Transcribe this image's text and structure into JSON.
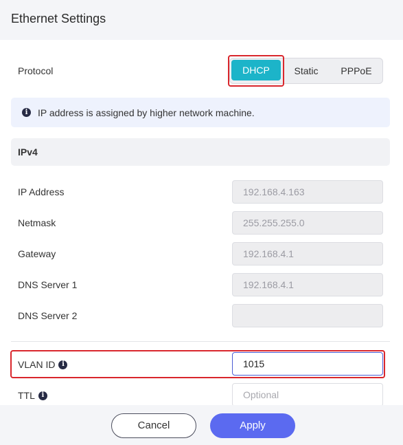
{
  "header": {
    "title": "Ethernet Settings"
  },
  "protocol": {
    "label": "Protocol",
    "options": [
      "DHCP",
      "Static",
      "PPPoE"
    ],
    "selected": "DHCP"
  },
  "info": {
    "text": "IP address is assigned by higher network machine."
  },
  "ipv4": {
    "section_title": "IPv4",
    "fields": [
      {
        "label": "IP Address",
        "value": "192.168.4.163"
      },
      {
        "label": "Netmask",
        "value": "255.255.255.0"
      },
      {
        "label": "Gateway",
        "value": "192.168.4.1"
      },
      {
        "label": "DNS Server 1",
        "value": "192.168.4.1"
      },
      {
        "label": "DNS Server 2",
        "value": ""
      }
    ]
  },
  "vlan": {
    "label": "VLAN ID",
    "value": "1015"
  },
  "ttl": {
    "label": "TTL",
    "value": "",
    "placeholder": "Optional"
  },
  "footer": {
    "cancel_label": "Cancel",
    "apply_label": "Apply"
  },
  "colors": {
    "accent": "#1cb4c9",
    "primary": "#5b6af0",
    "highlight": "#d9262c"
  },
  "icons": {
    "info": "info-circle-icon"
  }
}
